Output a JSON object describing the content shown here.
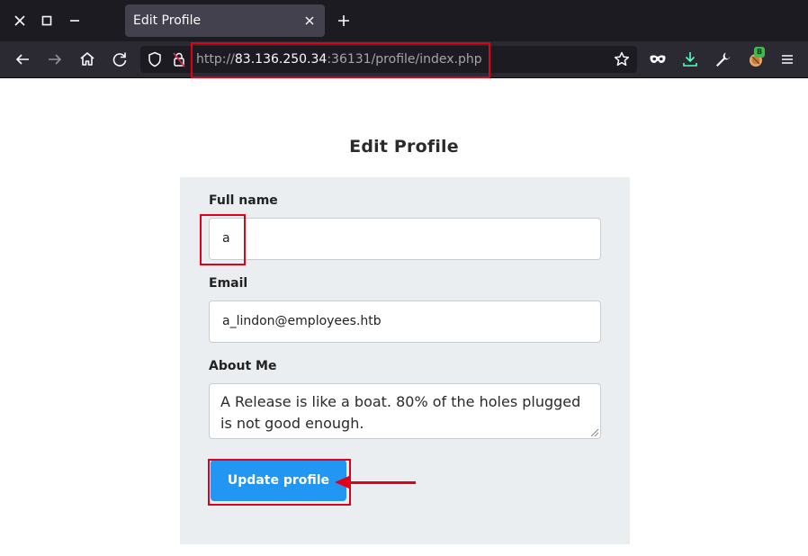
{
  "browser": {
    "tab_title": "Edit Profile",
    "url_prefix": "http://",
    "url_host": "83.136.250.34",
    "url_rest": ":36131/profile/index.php",
    "extension_badge": "B",
    "icons": {
      "close_window": "close-icon",
      "maximize_window": "maximize-icon",
      "minimize_window": "minimize-icon",
      "tab_close": "close-icon",
      "new_tab": "plus-icon",
      "back": "arrow-left-icon",
      "forward": "arrow-right-icon",
      "home": "home-icon",
      "reload": "reload-icon",
      "tracking_protection": "shield-icon",
      "insecure_connection": "lock-slash-icon",
      "bookmark": "star-icon",
      "private_mask": "mask-icon",
      "downloads": "download-icon",
      "tools": "wrench-icon",
      "extension": "extension-icon",
      "menu": "hamburger-icon"
    }
  },
  "page": {
    "title": "Edit Profile",
    "form": {
      "full_name_label": "Full name",
      "full_name_value": "a",
      "email_label": "Email",
      "email_value": "a_lindon@employees.htb",
      "about_label": "About Me",
      "about_value": "A Release is like a boat. 80% of the holes plugged is not good enough.",
      "submit_label": "Update profile"
    }
  },
  "colors": {
    "accent_button": "#2196f3",
    "annotation_red": "#e1001a",
    "card_background": "#ebeef1",
    "chrome_dark": "#1c1b22",
    "toolbar": "#2b2a33",
    "download_icon": "#54ffbd"
  }
}
